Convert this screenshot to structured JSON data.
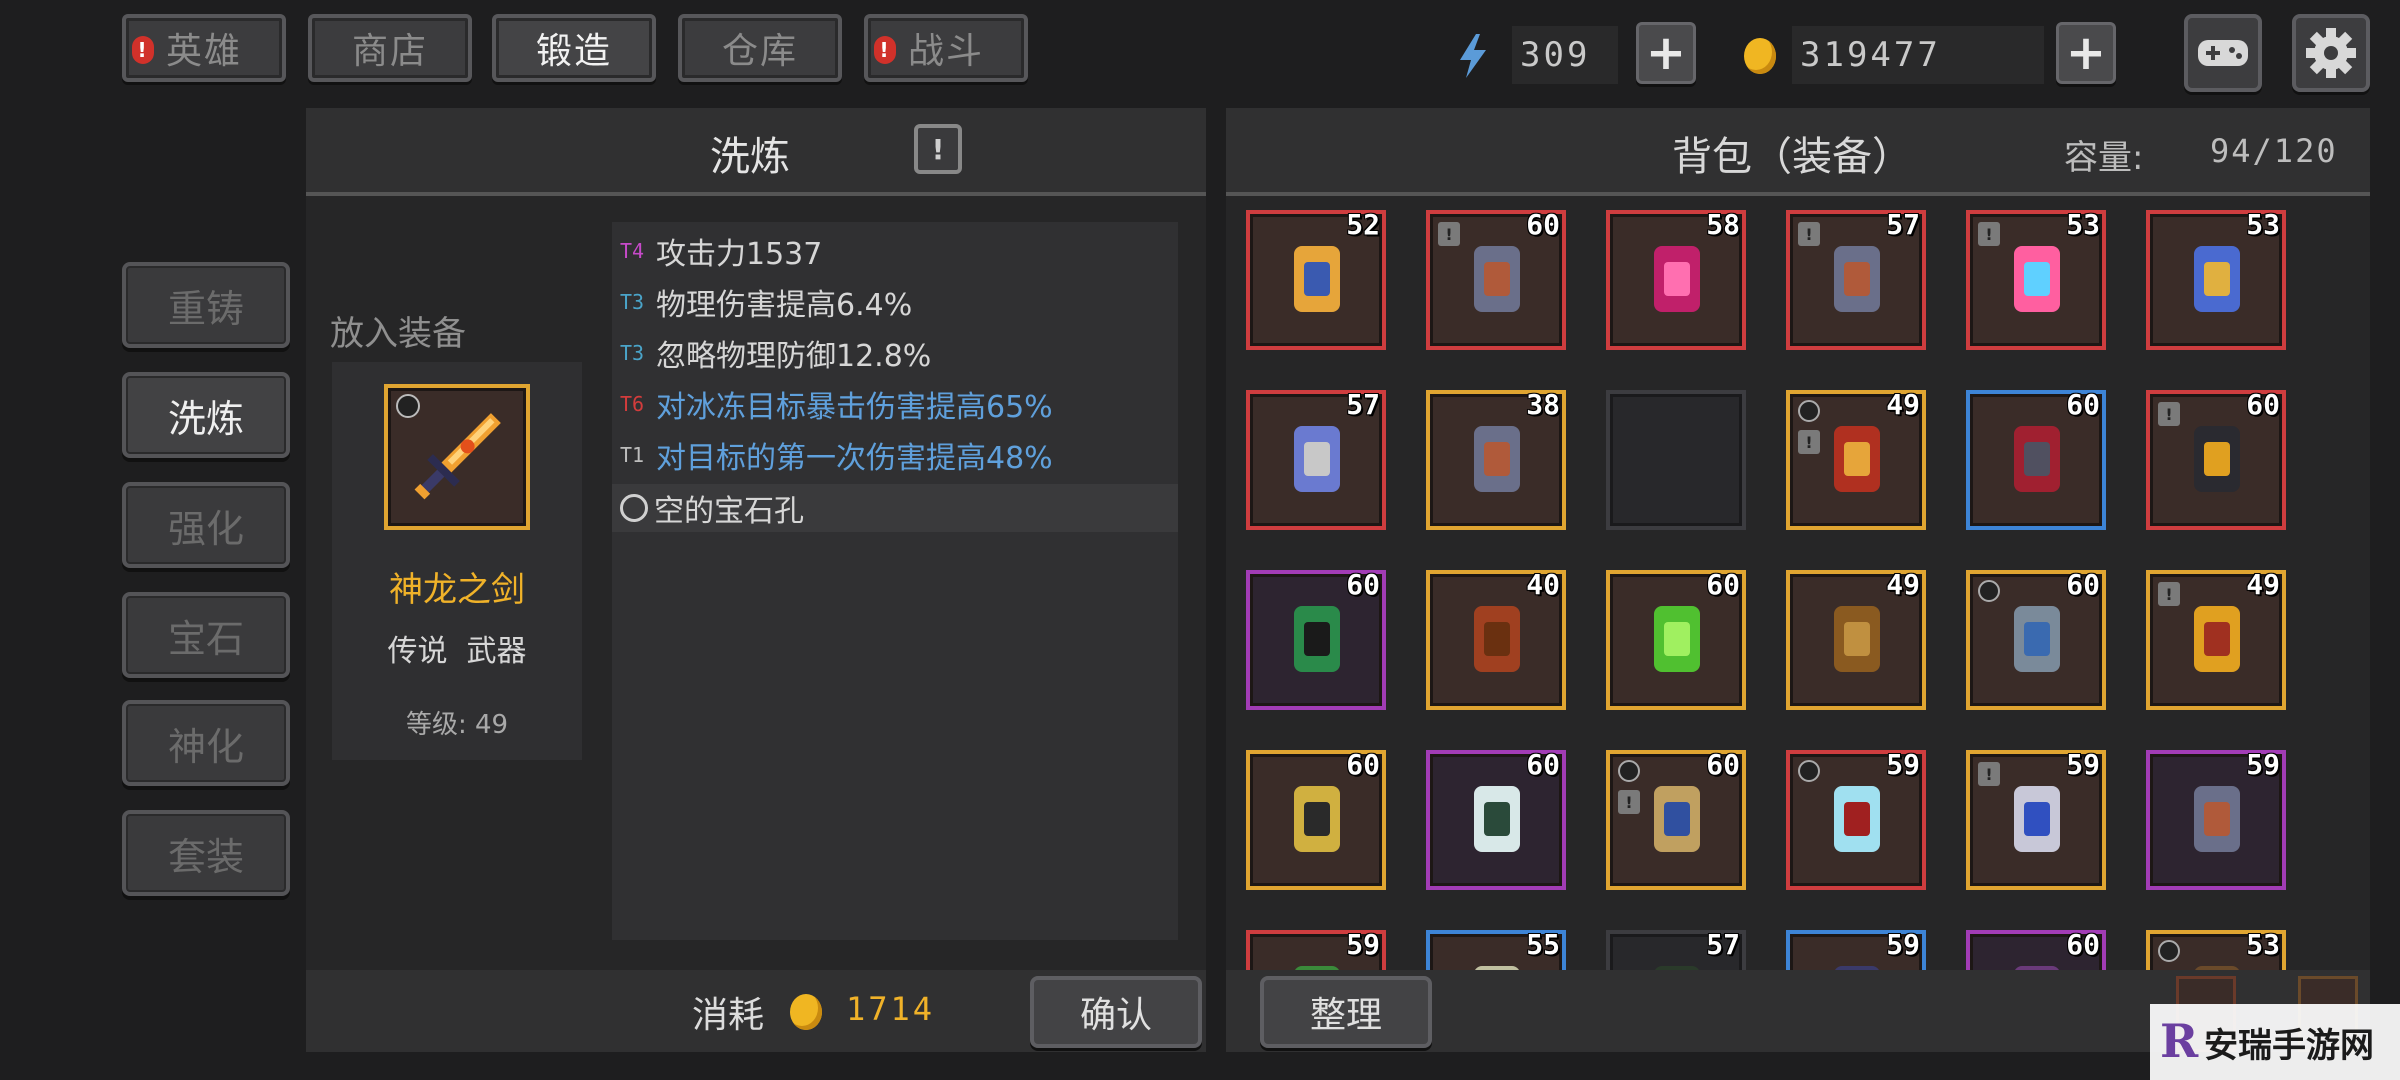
{
  "tabs": [
    {
      "label": "英雄",
      "alert": true
    },
    {
      "label": "商店",
      "alert": false
    },
    {
      "label": "锻造",
      "alert": false
    },
    {
      "label": "仓库",
      "alert": false
    },
    {
      "label": "战斗",
      "alert": true
    }
  ],
  "resources": {
    "energy": "309",
    "gold": "319477"
  },
  "side_menu": [
    "重铸",
    "洗炼",
    "强化",
    "宝石",
    "神化",
    "套装"
  ],
  "refine": {
    "title": "洗炼",
    "place_label": "放入装备",
    "item_name": "神龙之剑",
    "item_type": "传说  武器",
    "item_level": "等级: 49",
    "stats": [
      {
        "tier": "T4",
        "text": "攻击力1537",
        "tier_color": "#c64ac9",
        "text_color": "#d6d6d6"
      },
      {
        "tier": "T3",
        "text": "物理伤害提高6.4%",
        "tier_color": "#4aa4c9",
        "text_color": "#d6d6d6"
      },
      {
        "tier": "T3",
        "text": "忽略物理防御12.8%",
        "tier_color": "#4aa4c9",
        "text_color": "#d6d6d6"
      },
      {
        "tier": "T6",
        "text": "对冰冻目标暴击伤害提高65%",
        "tier_color": "#d23c3c",
        "text_color": "#5fa0dc"
      },
      {
        "tier": "T1",
        "text": "对目标的第一次伤害提高48%",
        "tier_color": "#bdbdbd",
        "text_color": "#5fa0dc"
      }
    ],
    "socket": "空的宝石孔",
    "cost_label": "消耗",
    "cost_value": "1714",
    "confirm": "确认"
  },
  "bag": {
    "title": "背包（装备）",
    "capacity_label": "容量:",
    "capacity_value": "94/120",
    "sort": "整理",
    "slots": [
      {
        "level": "52",
        "rarity": "red",
        "icon": "wing-boots-icon"
      },
      {
        "level": "60",
        "rarity": "red",
        "icon": "boots-icon",
        "lock": true
      },
      {
        "level": "58",
        "rarity": "red",
        "icon": "crimson-armor-icon"
      },
      {
        "level": "57",
        "rarity": "red",
        "icon": "boots-icon",
        "lock": true
      },
      {
        "level": "53",
        "rarity": "red",
        "icon": "rainbow-sword-icon",
        "lock": true
      },
      {
        "level": "53",
        "rarity": "red",
        "icon": "robe-icon"
      },
      {
        "level": "57",
        "rarity": "red",
        "icon": "battle-axe-icon"
      },
      {
        "level": "38",
        "rarity": "gold",
        "icon": "boots-icon"
      },
      {
        "level": "",
        "rarity": "empty",
        "icon": ""
      },
      {
        "level": "49",
        "rarity": "gold",
        "icon": "shield-icon",
        "ring": true,
        "lock": true
      },
      {
        "level": "60",
        "rarity": "blue",
        "icon": "crossbow-icon"
      },
      {
        "level": "60",
        "rarity": "red",
        "icon": "gauntlet-icon",
        "lock": true
      },
      {
        "level": "60",
        "rarity": "purple",
        "icon": "greaves-icon"
      },
      {
        "level": "40",
        "rarity": "gold",
        "icon": "hat-icon"
      },
      {
        "level": "60",
        "rarity": "gold",
        "icon": "green-staff-icon"
      },
      {
        "level": "49",
        "rarity": "gold",
        "icon": "wood-staff-icon"
      },
      {
        "level": "60",
        "rarity": "gold",
        "icon": "helmet-icon",
        "ring": true
      },
      {
        "level": "49",
        "rarity": "gold",
        "icon": "lamp-icon",
        "lock": true
      },
      {
        "level": "60",
        "rarity": "gold",
        "icon": "gold-armor-icon"
      },
      {
        "level": "60",
        "rarity": "purple",
        "icon": "hood-icon"
      },
      {
        "level": "60",
        "rarity": "gold",
        "icon": "hammer-icon",
        "ring": true,
        "lock": true
      },
      {
        "level": "59",
        "rarity": "red",
        "icon": "dagger-icon",
        "ring": true
      },
      {
        "level": "59",
        "rarity": "gold",
        "icon": "halberd-icon",
        "lock": true
      },
      {
        "level": "59",
        "rarity": "purple",
        "icon": "boots-icon"
      },
      {
        "level": "59",
        "rarity": "red",
        "icon": "green-item-icon"
      },
      {
        "level": "55",
        "rarity": "blue",
        "icon": "goggles-icon"
      },
      {
        "level": "57",
        "rarity": "empty",
        "icon": "dark-item-icon"
      },
      {
        "level": "59",
        "rarity": "blue",
        "icon": "blue-item-icon"
      },
      {
        "level": "60",
        "rarity": "purple",
        "icon": "purple-item-icon"
      },
      {
        "level": "53",
        "rarity": "gold",
        "icon": "brown-item-icon",
        "ring": true
      }
    ]
  },
  "watermark": "安瑞手游网"
}
